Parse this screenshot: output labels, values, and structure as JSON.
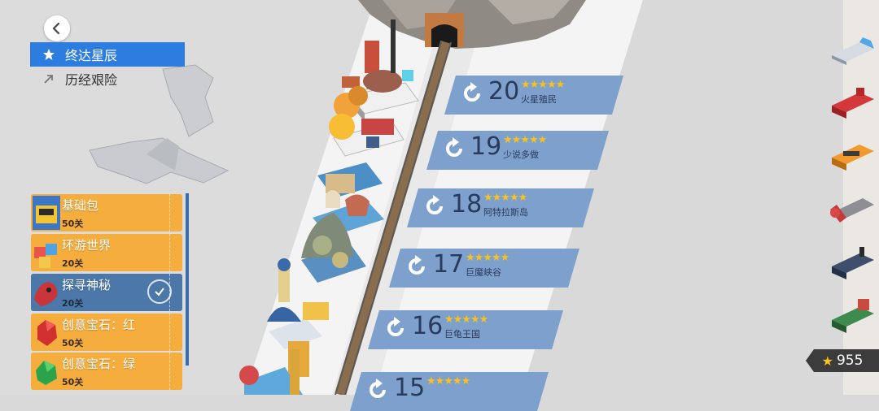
{
  "menu": {
    "items": [
      {
        "label": "终达星辰",
        "active": true,
        "icon": "star-icon"
      },
      {
        "label": "历经艰险",
        "active": false,
        "icon": "arrow-icon"
      }
    ]
  },
  "packs": [
    {
      "name": "基础包",
      "count": "50关",
      "color": "#f5ad3d",
      "selected": false
    },
    {
      "name": "环游世界",
      "count": "20关",
      "color": "#f5ad3d",
      "selected": false
    },
    {
      "name": "探寻神秘",
      "count": "20关",
      "color": "#4b78a8",
      "selected": true
    },
    {
      "name": "创意宝石：红",
      "count": "50关",
      "color": "#f5ad3d",
      "selected": false
    },
    {
      "name": "创意宝石：绿",
      "count": "50关",
      "color": "#f5ad3d",
      "selected": false
    }
  ],
  "levels": [
    {
      "number": "20",
      "stars": "★★★★★",
      "name": "火星殖民"
    },
    {
      "number": "19",
      "stars": "★★★★★",
      "name": "少说多做"
    },
    {
      "number": "18",
      "stars": "★★★★★",
      "name": "阿特拉斯岛"
    },
    {
      "number": "17",
      "stars": "★★★★★",
      "name": "巨魔峡谷"
    },
    {
      "number": "16",
      "stars": "★★★★★",
      "name": "巨龟王国"
    },
    {
      "number": "15",
      "stars": "★★★★★",
      "name": ""
    }
  ],
  "trains": [
    "silver-bullet-train-icon",
    "red-locomotive-icon",
    "orange-diesel-train-icon",
    "red-grey-engine-icon",
    "steam-locomotive-icon",
    "green-steam-train-icon"
  ],
  "score": {
    "star_icon": "star-icon",
    "value": "955"
  },
  "colors": {
    "accent": "#2d7de0",
    "pack_orange": "#f5ad3d",
    "pack_blue": "#4b78a8",
    "banner": "#7da0cc",
    "star": "#f7c21d"
  }
}
